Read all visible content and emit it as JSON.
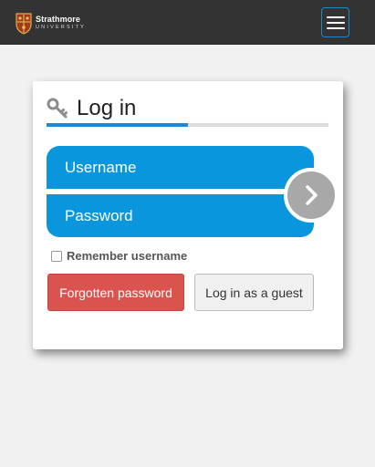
{
  "navbar": {
    "logo": {
      "name": "Strathmore",
      "subtitle": "UNIVERSITY"
    },
    "menu_icon": "hamburger-icon"
  },
  "login": {
    "title": "Log in",
    "title_icon": "key-icon",
    "progress": 0.5,
    "username_placeholder": "Username",
    "password_placeholder": "Password",
    "submit_icon": "chevron-right-icon",
    "remember_label": "Remember username",
    "remember_checked": false,
    "forgot_label": "Forgotten password",
    "guest_label": "Log in as a guest"
  },
  "colors": {
    "navbar_bg": "#333333",
    "accent_blue": "#0a96dc",
    "danger": "#d9534f",
    "page_bg": "#f1f1f1"
  }
}
